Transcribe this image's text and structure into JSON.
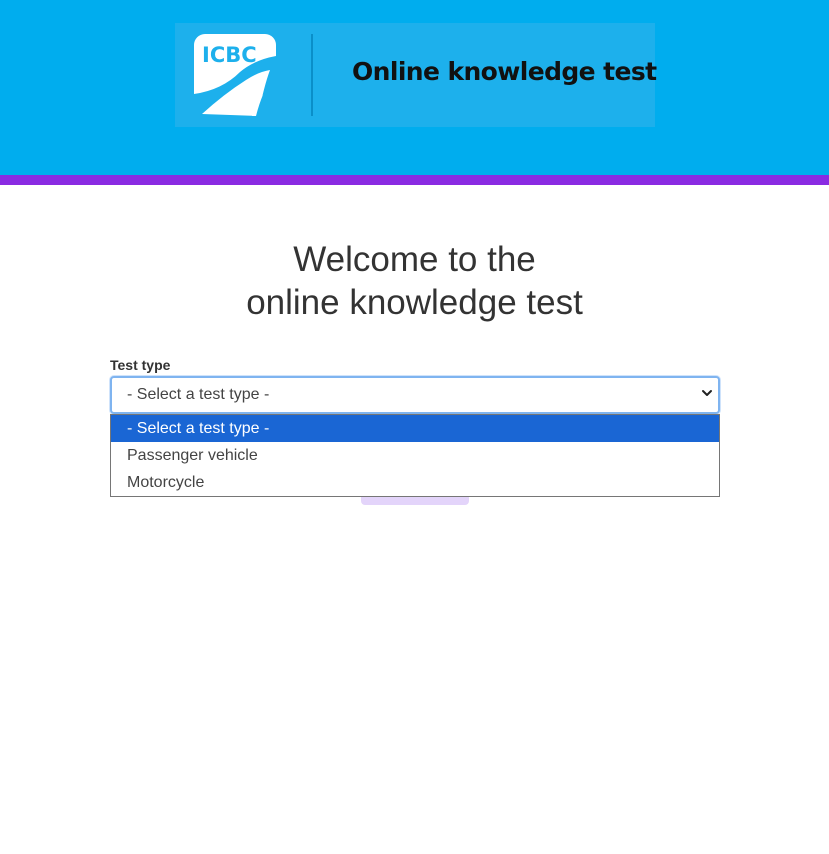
{
  "header": {
    "logo_text": "ICBC",
    "title": "Online knowledge test",
    "colors": {
      "header_bg": "#00adee",
      "stripe": "#8a2be2"
    }
  },
  "main": {
    "heading_line1": "Welcome to the",
    "heading_line2": "online knowledge test",
    "test_type": {
      "label": "Test type",
      "selected_value": "- Select a test type -",
      "options": [
        "- Select a test type -",
        "Passenger vehicle",
        "Motorcycle"
      ],
      "highlighted_index": 0,
      "dropdown_open": true
    }
  },
  "icons": {
    "select_chevron": "chevron-down-icon",
    "logo": "icbc-logo-icon"
  }
}
